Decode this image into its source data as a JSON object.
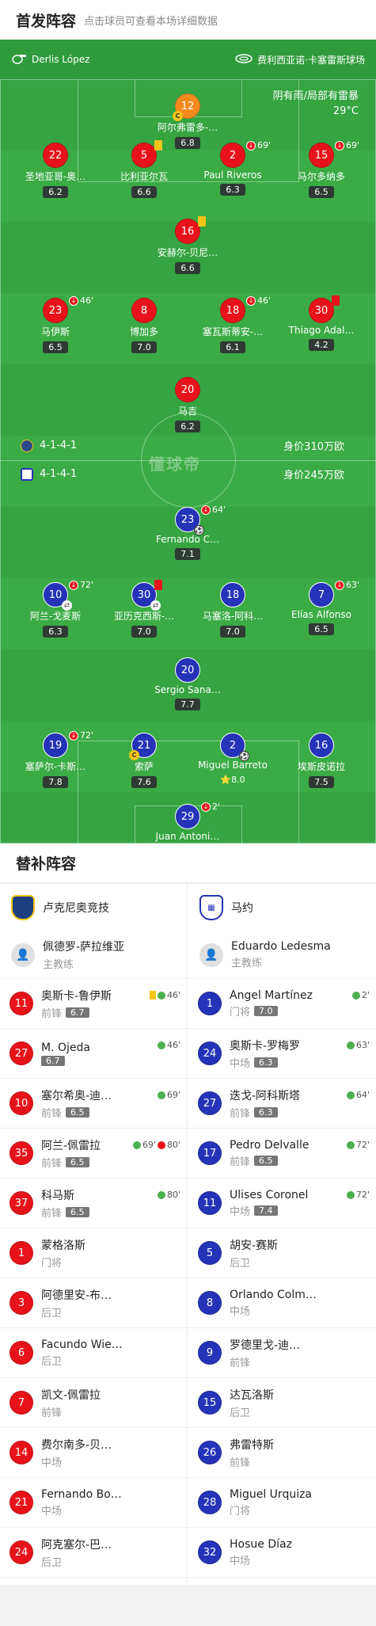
{
  "header": {
    "title": "首发阵容",
    "subtitle": "点击球员可查看本场详细数据"
  },
  "pitch": {
    "referee": "Derlis López",
    "stadium": "费利西亚诺·卡塞雷斯球场",
    "weather": "阴有雨/局部有雷暴",
    "temperature": "29°C",
    "brand": "懂球帝",
    "home": {
      "formation": "4-1-4-1",
      "value": "身价310万欧",
      "color": "#e8131a"
    },
    "away": {
      "formation": "4-1-4-1",
      "value": "身价245万欧",
      "color": "#2533b8"
    }
  },
  "home_players": [
    {
      "num": "12",
      "name": "阿尔弗雷多-…",
      "rating": "6.8",
      "gk": true,
      "captain": true
    },
    {
      "num": "22",
      "name": "圣地亚哥-奥…",
      "rating": "6.2"
    },
    {
      "num": "5",
      "name": "比利亚尔瓦",
      "rating": "6.6",
      "yellow": true
    },
    {
      "num": "2",
      "name": "Paul Riveros",
      "rating": "6.3",
      "sub": "69'"
    },
    {
      "num": "15",
      "name": "马尔多纳多",
      "rating": "6.5",
      "sub": "69'"
    },
    {
      "num": "16",
      "name": "安赫尔-贝尼…",
      "rating": "6.6",
      "yellow": true
    },
    {
      "num": "23",
      "name": "马伊斯",
      "rating": "6.5",
      "sub": "46'"
    },
    {
      "num": "8",
      "name": "博加多",
      "rating": "7.0"
    },
    {
      "num": "18",
      "name": "塞瓦斯蒂安-…",
      "rating": "6.1",
      "sub": "46'"
    },
    {
      "num": "30",
      "name": "Thiago Adal…",
      "rating": "4.2",
      "red": true
    },
    {
      "num": "20",
      "name": "马吉",
      "rating": "6.2"
    }
  ],
  "away_players": [
    {
      "num": "23",
      "name": "Fernando C…",
      "rating": "7.1",
      "sub": "64'",
      "goal": true
    },
    {
      "num": "10",
      "name": "阿兰-戈麦斯",
      "rating": "6.3",
      "sub": "72'",
      "subin": true
    },
    {
      "num": "30",
      "name": "亚历克西斯-…",
      "rating": "7.0",
      "red": true,
      "subin": true
    },
    {
      "num": "18",
      "name": "马塞洛-阿科…",
      "rating": "7.0"
    },
    {
      "num": "7",
      "name": "Elías Alfonso",
      "rating": "6.5",
      "sub": "63'"
    },
    {
      "num": "20",
      "name": "Sergio Sana…",
      "rating": "7.7"
    },
    {
      "num": "19",
      "name": "塞萨尔-卡斯…",
      "rating": "7.8",
      "sub": "72'"
    },
    {
      "num": "21",
      "name": "索萨",
      "rating": "7.6",
      "captain": true
    },
    {
      "num": "2",
      "name": "Miguel Barreto",
      "rating": "8.0",
      "goal": true,
      "star": true
    },
    {
      "num": "16",
      "name": "埃斯皮诺拉",
      "rating": "7.5"
    },
    {
      "num": "29",
      "name": "Juan Antoni…",
      "rating": "",
      "sub": "2'"
    }
  ],
  "bench": {
    "title": "替补阵容",
    "home": {
      "team": "卢克尼奥竞技",
      "coach": "佩德罗-萨拉维亚",
      "coach_role": "主教练",
      "players": [
        {
          "num": "11",
          "name": "奥斯卡-鲁伊斯",
          "pos": "前锋",
          "rating": "6.7",
          "ev": "46'",
          "yellow": true
        },
        {
          "num": "27",
          "name": "M. Ojeda",
          "pos": "",
          "rating": "6.7",
          "ev": "46'"
        },
        {
          "num": "10",
          "name": "塞尔希奥-迪…",
          "pos": "前锋",
          "rating": "6.5",
          "ev": "69'"
        },
        {
          "num": "35",
          "name": "阿兰-佩雷拉",
          "pos": "前锋",
          "rating": "6.5",
          "ev": "69'",
          "ev2": "80'"
        },
        {
          "num": "37",
          "name": "科马斯",
          "pos": "前锋",
          "rating": "6.5",
          "ev": "80'"
        },
        {
          "num": "1",
          "name": "蒙格洛斯",
          "pos": "门将",
          "rating": ""
        },
        {
          "num": "3",
          "name": "阿德里安-布…",
          "pos": "后卫",
          "rating": ""
        },
        {
          "num": "6",
          "name": "Facundo Wie…",
          "pos": "后卫",
          "rating": ""
        },
        {
          "num": "7",
          "name": "凯文-佩雷拉",
          "pos": "前锋",
          "rating": ""
        },
        {
          "num": "14",
          "name": "费尔南多-贝…",
          "pos": "中场",
          "rating": ""
        },
        {
          "num": "21",
          "name": "Fernando Bo…",
          "pos": "中场",
          "rating": ""
        },
        {
          "num": "24",
          "name": "阿克塞尔-巴…",
          "pos": "后卫",
          "rating": ""
        }
      ]
    },
    "away": {
      "team": "马约",
      "coach": "Eduardo Ledesma",
      "coach_role": "主教练",
      "players": [
        {
          "num": "1",
          "name": "Ángel Martínez",
          "pos": "门将",
          "rating": "7.0",
          "ev": "2'"
        },
        {
          "num": "24",
          "name": "奥斯卡-罗梅罗",
          "pos": "中场",
          "rating": "6.3",
          "ev": "63'"
        },
        {
          "num": "27",
          "name": "迭戈-阿科斯塔",
          "pos": "前锋",
          "rating": "6.3",
          "ev": "64'"
        },
        {
          "num": "17",
          "name": "Pedro Delvalle",
          "pos": "前锋",
          "rating": "6.5",
          "ev": "72'"
        },
        {
          "num": "11",
          "name": "Ulises Coronel",
          "pos": "中场",
          "rating": "7.4",
          "ev": "72'"
        },
        {
          "num": "5",
          "name": "胡安-赛斯",
          "pos": "后卫",
          "rating": ""
        },
        {
          "num": "8",
          "name": "Orlando Colm…",
          "pos": "中场",
          "rating": ""
        },
        {
          "num": "9",
          "name": "罗德里戈-迪…",
          "pos": "前锋",
          "rating": ""
        },
        {
          "num": "15",
          "name": "达瓦洛斯",
          "pos": "后卫",
          "rating": ""
        },
        {
          "num": "26",
          "name": "弗雷特斯",
          "pos": "前锋",
          "rating": ""
        },
        {
          "num": "28",
          "name": "Miguel Urquiza",
          "pos": "门将",
          "rating": ""
        },
        {
          "num": "32",
          "name": "Hosue Díaz",
          "pos": "中场",
          "rating": ""
        }
      ]
    }
  }
}
